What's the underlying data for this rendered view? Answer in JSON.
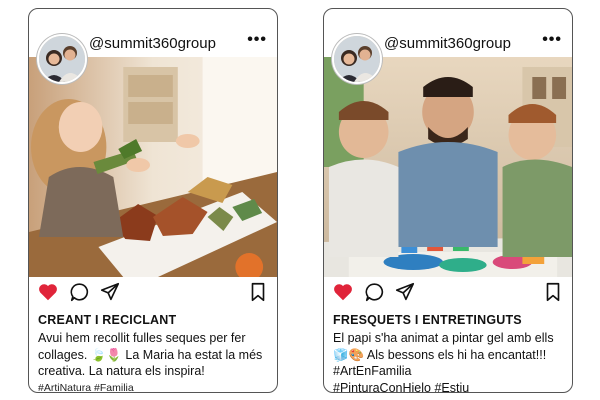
{
  "posts": [
    {
      "username": "@summit360group",
      "title": "CREANT I RECICLANT",
      "caption": "Avui hem recollit fulles seques per fer collages. 🍃🌷 La Maria ha estat la més creativa. La natura els inspira!",
      "hashtags": "#ArtiNatura #Familia",
      "liked": true,
      "like_color": "#e0243a"
    },
    {
      "username": "@summit360group",
      "title": "FRESQUETS I ENTRETINGUTS",
      "caption": "El papi s'ha animat a pintar gel amb ells🧊🎨 Als bessons els hi ha encantat!!! #ArtEnFamilia",
      "hashtags": "#PinturaConHielo #Estiu",
      "liked": true,
      "like_color": "#e0243a"
    }
  ],
  "icons": {
    "more": "ellipsis-icon",
    "like": "heart-icon",
    "comment": "comment-icon",
    "share": "send-icon",
    "save": "bookmark-icon"
  },
  "more_label": "•••"
}
